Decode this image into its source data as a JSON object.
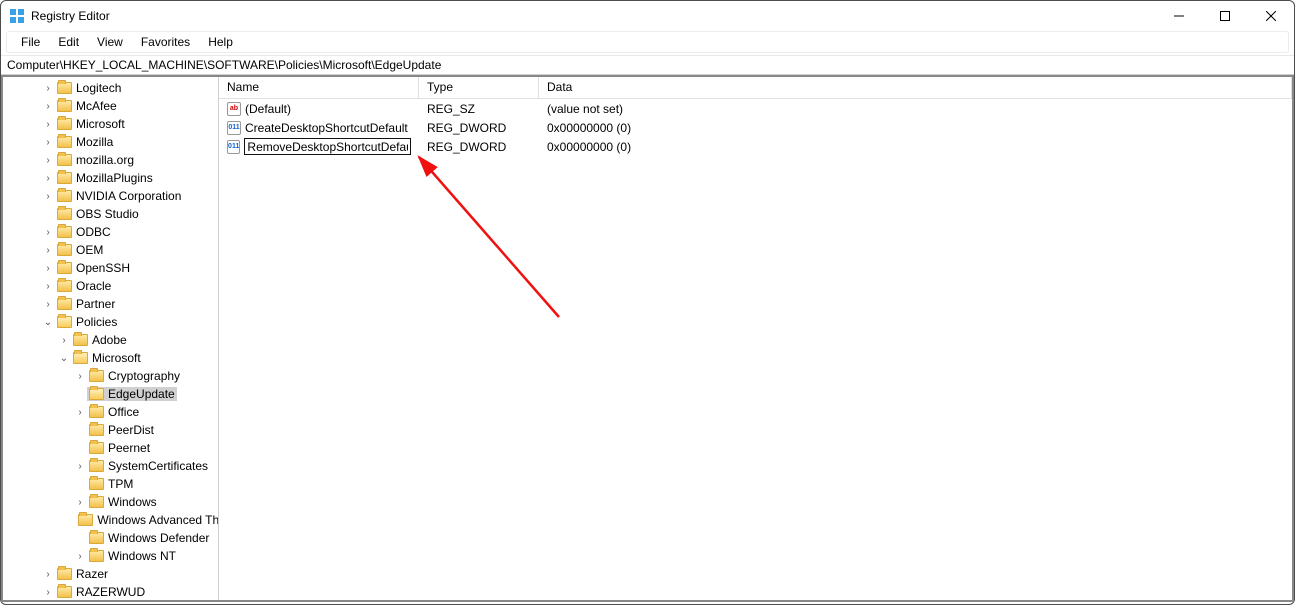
{
  "window": {
    "title": "Registry Editor"
  },
  "menu": {
    "items": [
      "File",
      "Edit",
      "View",
      "Favorites",
      "Help"
    ]
  },
  "address": "Computer\\HKEY_LOCAL_MACHINE\\SOFTWARE\\Policies\\Microsoft\\EdgeUpdate",
  "columns": {
    "name": "Name",
    "type": "Type",
    "data": "Data"
  },
  "values": [
    {
      "icon": "sz",
      "name": "(Default)",
      "type": "REG_SZ",
      "data": "(value not set)",
      "editing": false
    },
    {
      "icon": "dw",
      "name": "CreateDesktopShortcutDefault",
      "type": "REG_DWORD",
      "data": "0x00000000 (0)",
      "editing": false
    },
    {
      "icon": "dw",
      "name": "RemoveDesktopShortcutDefault",
      "type": "REG_DWORD",
      "data": "0x00000000 (0)",
      "editing": true
    }
  ],
  "tree": [
    {
      "indent": 2,
      "twisty": ">",
      "label": "Logitech"
    },
    {
      "indent": 2,
      "twisty": ">",
      "label": "McAfee"
    },
    {
      "indent": 2,
      "twisty": ">",
      "label": "Microsoft"
    },
    {
      "indent": 2,
      "twisty": ">",
      "label": "Mozilla"
    },
    {
      "indent": 2,
      "twisty": ">",
      "label": "mozilla.org"
    },
    {
      "indent": 2,
      "twisty": ">",
      "label": "MozillaPlugins"
    },
    {
      "indent": 2,
      "twisty": ">",
      "label": "NVIDIA Corporation"
    },
    {
      "indent": 2,
      "twisty": " ",
      "label": "OBS Studio"
    },
    {
      "indent": 2,
      "twisty": ">",
      "label": "ODBC"
    },
    {
      "indent": 2,
      "twisty": ">",
      "label": "OEM"
    },
    {
      "indent": 2,
      "twisty": ">",
      "label": "OpenSSH"
    },
    {
      "indent": 2,
      "twisty": ">",
      "label": "Oracle"
    },
    {
      "indent": 2,
      "twisty": ">",
      "label": "Partner"
    },
    {
      "indent": 2,
      "twisty": "v",
      "label": "Policies",
      "open": true
    },
    {
      "indent": 3,
      "twisty": ">",
      "label": "Adobe"
    },
    {
      "indent": 3,
      "twisty": "v",
      "label": "Microsoft",
      "open": true
    },
    {
      "indent": 4,
      "twisty": ">",
      "label": "Cryptography"
    },
    {
      "indent": 4,
      "twisty": " ",
      "label": "EdgeUpdate",
      "selected": true,
      "open": true
    },
    {
      "indent": 4,
      "twisty": ">",
      "label": "Office"
    },
    {
      "indent": 4,
      "twisty": " ",
      "label": "PeerDist"
    },
    {
      "indent": 4,
      "twisty": " ",
      "label": "Peernet"
    },
    {
      "indent": 4,
      "twisty": ">",
      "label": "SystemCertificates"
    },
    {
      "indent": 4,
      "twisty": " ",
      "label": "TPM"
    },
    {
      "indent": 4,
      "twisty": ">",
      "label": "Windows"
    },
    {
      "indent": 4,
      "twisty": " ",
      "label": "Windows Advanced Threat Protection"
    },
    {
      "indent": 4,
      "twisty": " ",
      "label": "Windows Defender"
    },
    {
      "indent": 4,
      "twisty": ">",
      "label": "Windows NT"
    },
    {
      "indent": 2,
      "twisty": ">",
      "label": "Razer"
    },
    {
      "indent": 2,
      "twisty": ">",
      "label": "RAZERWUD"
    }
  ],
  "icon_text": {
    "sz": "ab",
    "dw": "011"
  }
}
